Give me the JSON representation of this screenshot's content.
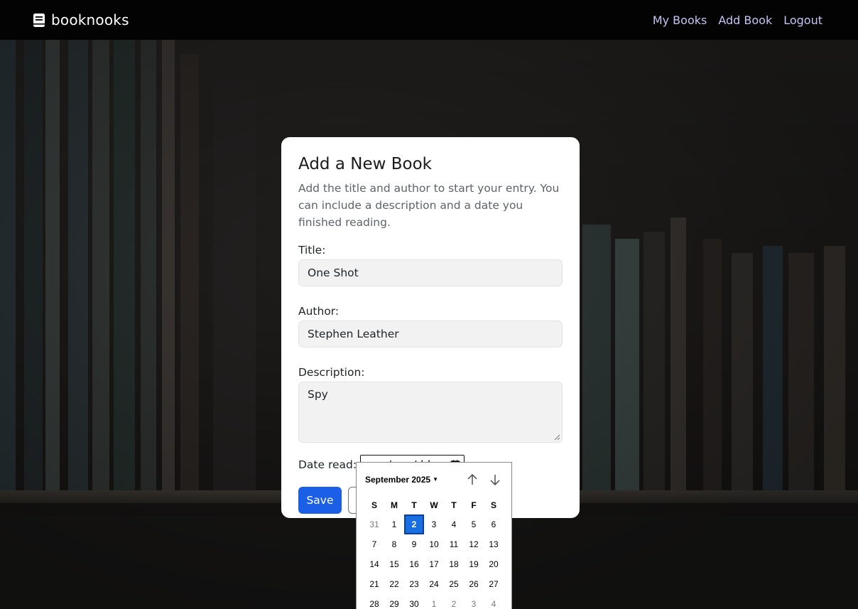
{
  "navbar": {
    "brand": "booknooks",
    "links": [
      "My Books",
      "Add Book",
      "Logout"
    ]
  },
  "form": {
    "title": "Add a New Book",
    "lead": "Add the title and author to start your entry. You can include a description and a date you finished reading.",
    "title_label": "Title:",
    "title_value": "One Shot",
    "author_label": "Author:",
    "author_value": "Stephen Leather",
    "description_label": "Description:",
    "description_value": "Spy",
    "date_label": "Date read:",
    "date_placeholder": "yyyy/mm/dd",
    "save_label": "Save",
    "cancel_label": ""
  },
  "calendar": {
    "month_label": "September 2025",
    "weekdays": [
      "S",
      "M",
      "T",
      "W",
      "T",
      "F",
      "S"
    ],
    "selected_day": "2",
    "days": [
      {
        "d": "31",
        "muted": true
      },
      {
        "d": "1"
      },
      {
        "d": "2",
        "selected": true
      },
      {
        "d": "3"
      },
      {
        "d": "4"
      },
      {
        "d": "5"
      },
      {
        "d": "6"
      },
      {
        "d": "7"
      },
      {
        "d": "8"
      },
      {
        "d": "9"
      },
      {
        "d": "10"
      },
      {
        "d": "11"
      },
      {
        "d": "12"
      },
      {
        "d": "13"
      },
      {
        "d": "14"
      },
      {
        "d": "15"
      },
      {
        "d": "16"
      },
      {
        "d": "17"
      },
      {
        "d": "18"
      },
      {
        "d": "19"
      },
      {
        "d": "20"
      },
      {
        "d": "21"
      },
      {
        "d": "22"
      },
      {
        "d": "23"
      },
      {
        "d": "24"
      },
      {
        "d": "25"
      },
      {
        "d": "26"
      },
      {
        "d": "27"
      },
      {
        "d": "28"
      },
      {
        "d": "29"
      },
      {
        "d": "30"
      },
      {
        "d": "1",
        "muted": true
      },
      {
        "d": "2",
        "muted": true
      },
      {
        "d": "3",
        "muted": true
      },
      {
        "d": "4",
        "muted": true
      }
    ]
  },
  "colors": {
    "primary": "#1a5fe6",
    "nav_link": "#c8c3f5",
    "navbar_bg": "#030303",
    "selected_day": "#1a6fe0"
  },
  "icons": [
    "book-icon",
    "calendar-icon",
    "arrow-up-icon",
    "arrow-down-icon",
    "caret-down-icon"
  ]
}
